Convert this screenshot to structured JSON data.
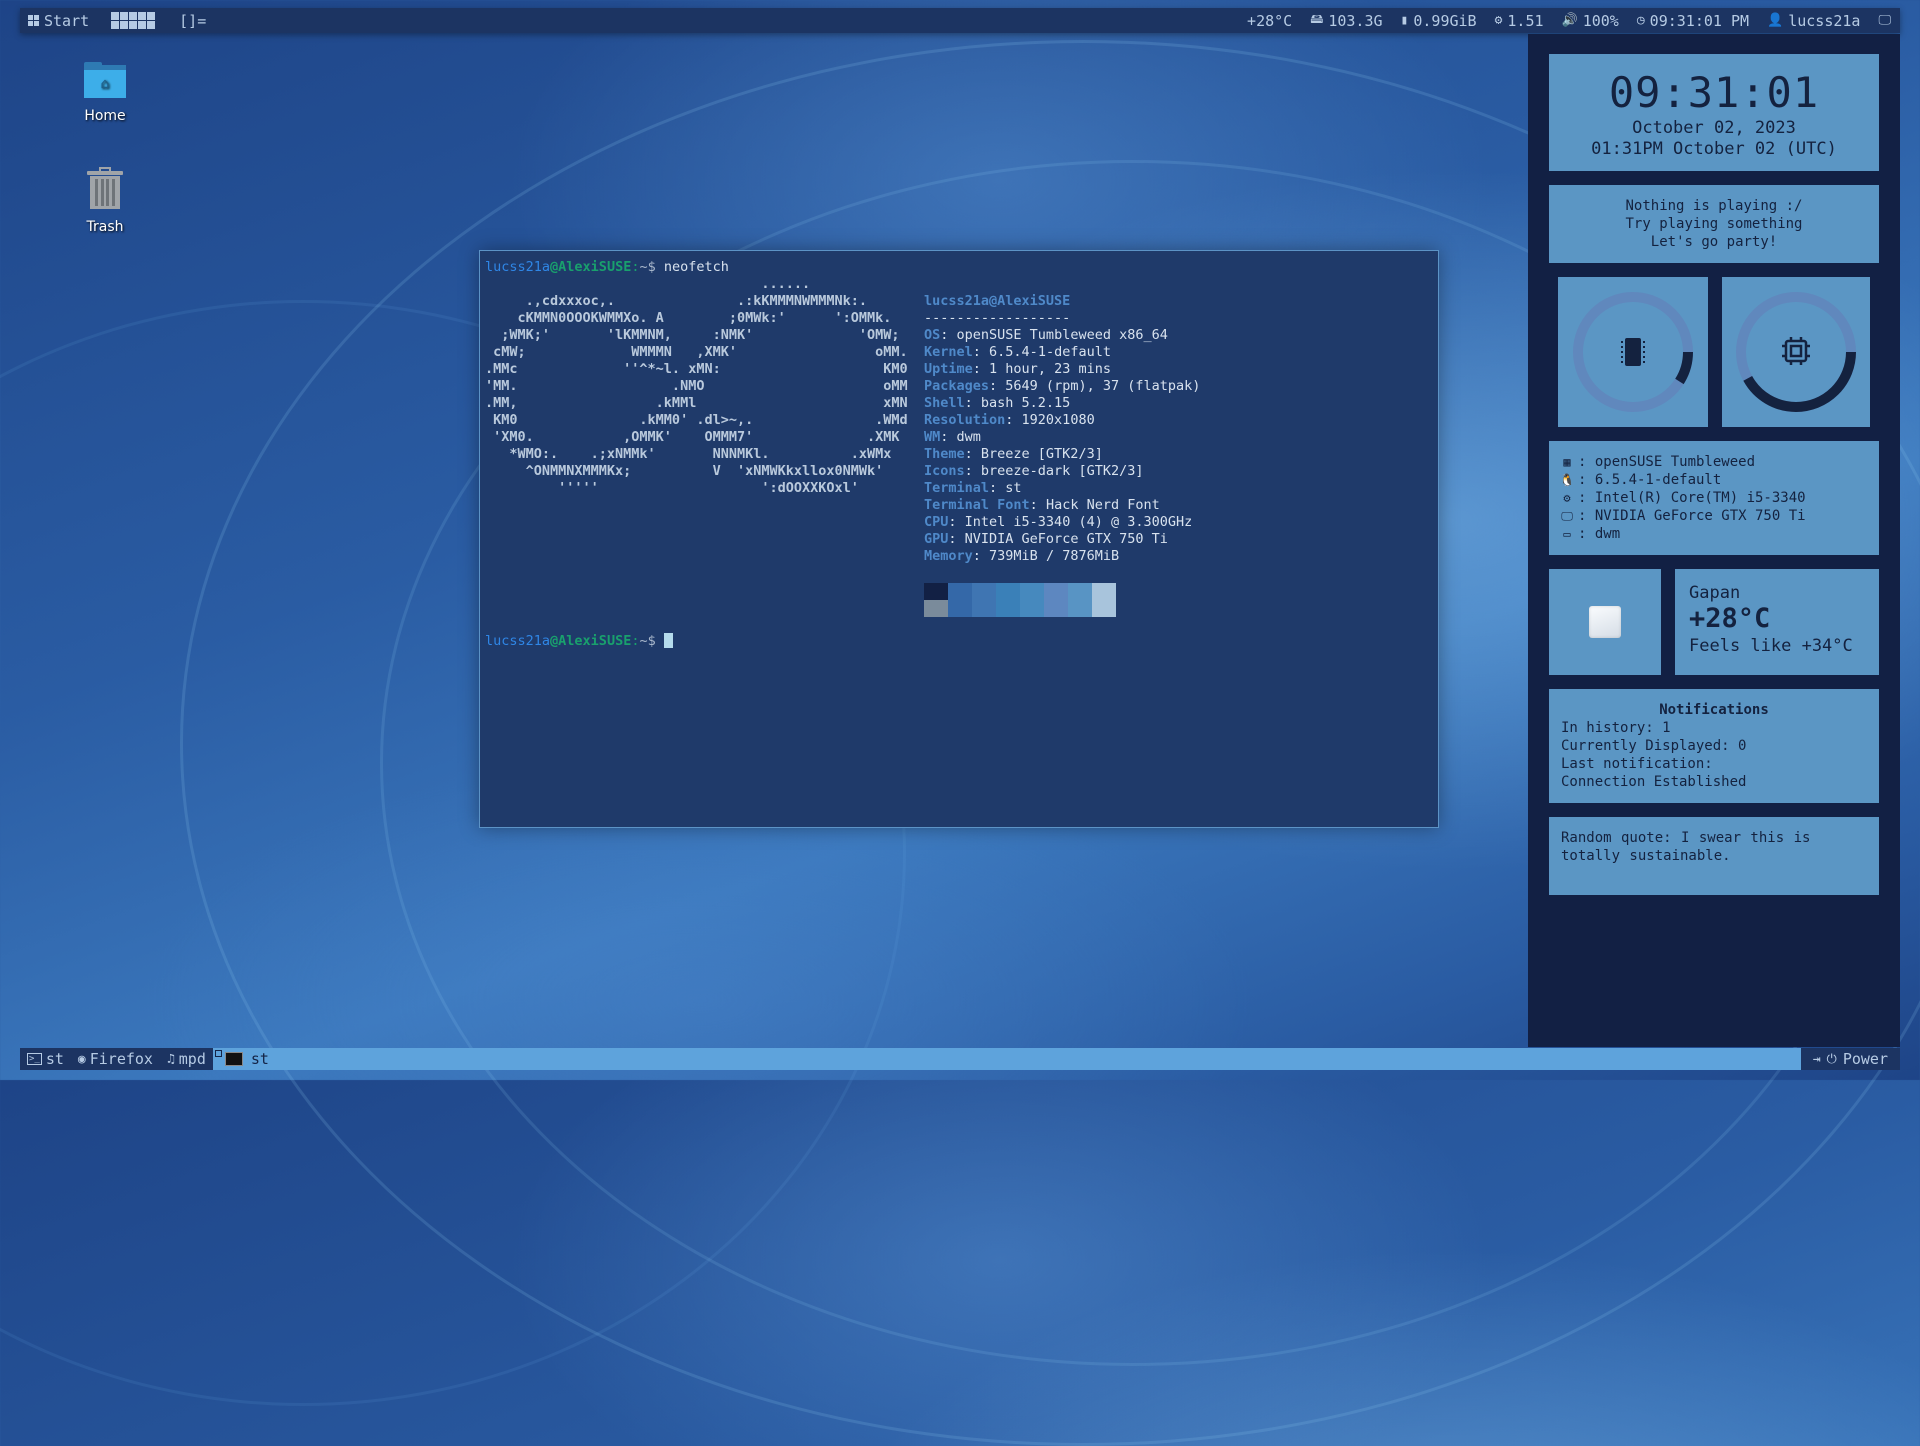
{
  "topbar": {
    "start_label": "Start",
    "layout_symbol": "[]=",
    "status": {
      "temperature": "+28°C",
      "disk": "103.3G",
      "memory": "0.99GiB",
      "cpu_load": "1.51",
      "volume": "100%",
      "clock": "09:31:01 PM",
      "user": "lucss21a"
    }
  },
  "desktop": {
    "icons": [
      {
        "label": "Home",
        "icon": "home-folder-icon"
      },
      {
        "label": "Trash",
        "icon": "trash-icon"
      }
    ]
  },
  "terminal": {
    "prompt": {
      "user": "lucss21a",
      "at": "@",
      "host": "AlexiSUSE",
      "path": ":~$ "
    },
    "command": "neofetch",
    "ascii_art": [
      "                                  ......",
      "     .,cdxxxoc,.               .:kKMMMNWMMMNk:.",
      "    cKMMN0OOOKWMMXo. A        ;0MWk:'      ':OMMk.",
      "  ;WMK;'       'lKMMNM,     :NMK'             'OMW;",
      " cMW;             WMMMN   ,XMK'                 oMM.",
      ".MMc             ''^*~l. xMN:                    KM0",
      "'MM.                   .NMO                      oMM",
      ".MM,                 .kMMl                       xMN",
      " KM0               .kMM0' .dl>~,.               .WMd",
      " 'XM0.           ,OMMK'    OMMM7'              .XMK",
      "   *WMO:.    .;xNMMk'       NNNMKl.          .xWMx",
      "     ^ONMMNXMMMKx;          V  'xNMWKkxllox0NMWk'",
      "         '''''                    ':dOOXXKOxl'"
    ],
    "info_title": "lucss21a@AlexiSUSE",
    "info_separator": "------------------",
    "info": [
      {
        "key": "OS",
        "value": "openSUSE Tumbleweed x86_64"
      },
      {
        "key": "Kernel",
        "value": "6.5.4-1-default"
      },
      {
        "key": "Uptime",
        "value": "1 hour, 23 mins"
      },
      {
        "key": "Packages",
        "value": "5649 (rpm), 37 (flatpak)"
      },
      {
        "key": "Shell",
        "value": "bash 5.2.15"
      },
      {
        "key": "Resolution",
        "value": "1920x1080"
      },
      {
        "key": "WM",
        "value": "dwm"
      },
      {
        "key": "Theme",
        "value": "Breeze [GTK2/3]"
      },
      {
        "key": "Icons",
        "value": "breeze-dark [GTK2/3]"
      },
      {
        "key": "Terminal",
        "value": "st"
      },
      {
        "key": "Terminal Font",
        "value": "Hack Nerd Font"
      },
      {
        "key": "CPU",
        "value": "Intel i5-3340 (4) @ 3.300GHz"
      },
      {
        "key": "GPU",
        "value": "NVIDIA GeForce GTX 750 Ti"
      },
      {
        "key": "Memory",
        "value": "739MiB / 7876MiB"
      }
    ],
    "palette_top": [
      "#122044",
      "#3468a8",
      "#3f75b2",
      "#3a80b8",
      "#4689be",
      "#5d87c0",
      "#5894c4",
      "#a8c4dc"
    ],
    "palette_bottom": [
      "#7a8b9b",
      "#3468a8",
      "#3f75b2",
      "#3a80b8",
      "#4689be",
      "#5d87c0",
      "#5894c4",
      "#a8c4dc"
    ]
  },
  "sidebar": {
    "clock": {
      "time": "09:31:01",
      "date": "October 02, 2023",
      "utc": "01:31PM October 02 (UTC)"
    },
    "music": {
      "lines": [
        "Nothing is playing :/",
        "Try playing something",
        "Let's go party!"
      ]
    },
    "gauges": {
      "memory_usage": 0.09,
      "cpu_usage": 0.42
    },
    "sysinfo": [
      {
        "icon": "distro-icon",
        "glyph": "▦",
        "value": "openSUSE Tumbleweed"
      },
      {
        "icon": "linux-icon",
        "glyph": "🐧",
        "value": "6.5.4-1-default"
      },
      {
        "icon": "cpu-icon",
        "glyph": "⚙",
        "value": "Intel(R) Core(TM) i5-3340"
      },
      {
        "icon": "monitor-icon",
        "glyph": "🖵",
        "value": "NVIDIA GeForce GTX 750 Ti"
      },
      {
        "icon": "window-icon",
        "glyph": "▭",
        "value": "dwm"
      }
    ],
    "weather": {
      "city": "Gapan",
      "temp": "+28°C",
      "feels": "Feels like +34°C"
    },
    "notifications": {
      "title": "Notifications",
      "lines": [
        "In history: 1",
        "Currently Displayed: 0",
        "Last notification:",
        "Connection Established"
      ]
    },
    "quote": "Random quote: I swear this is totally sustainable."
  },
  "bottombar": {
    "items": [
      {
        "label": "st",
        "icon": "terminal-icon"
      },
      {
        "label": "Firefox",
        "icon": "firefox-icon"
      },
      {
        "label": "mpd",
        "icon": "music-note-icon"
      }
    ],
    "active_window": "st",
    "power_label": "Power"
  }
}
